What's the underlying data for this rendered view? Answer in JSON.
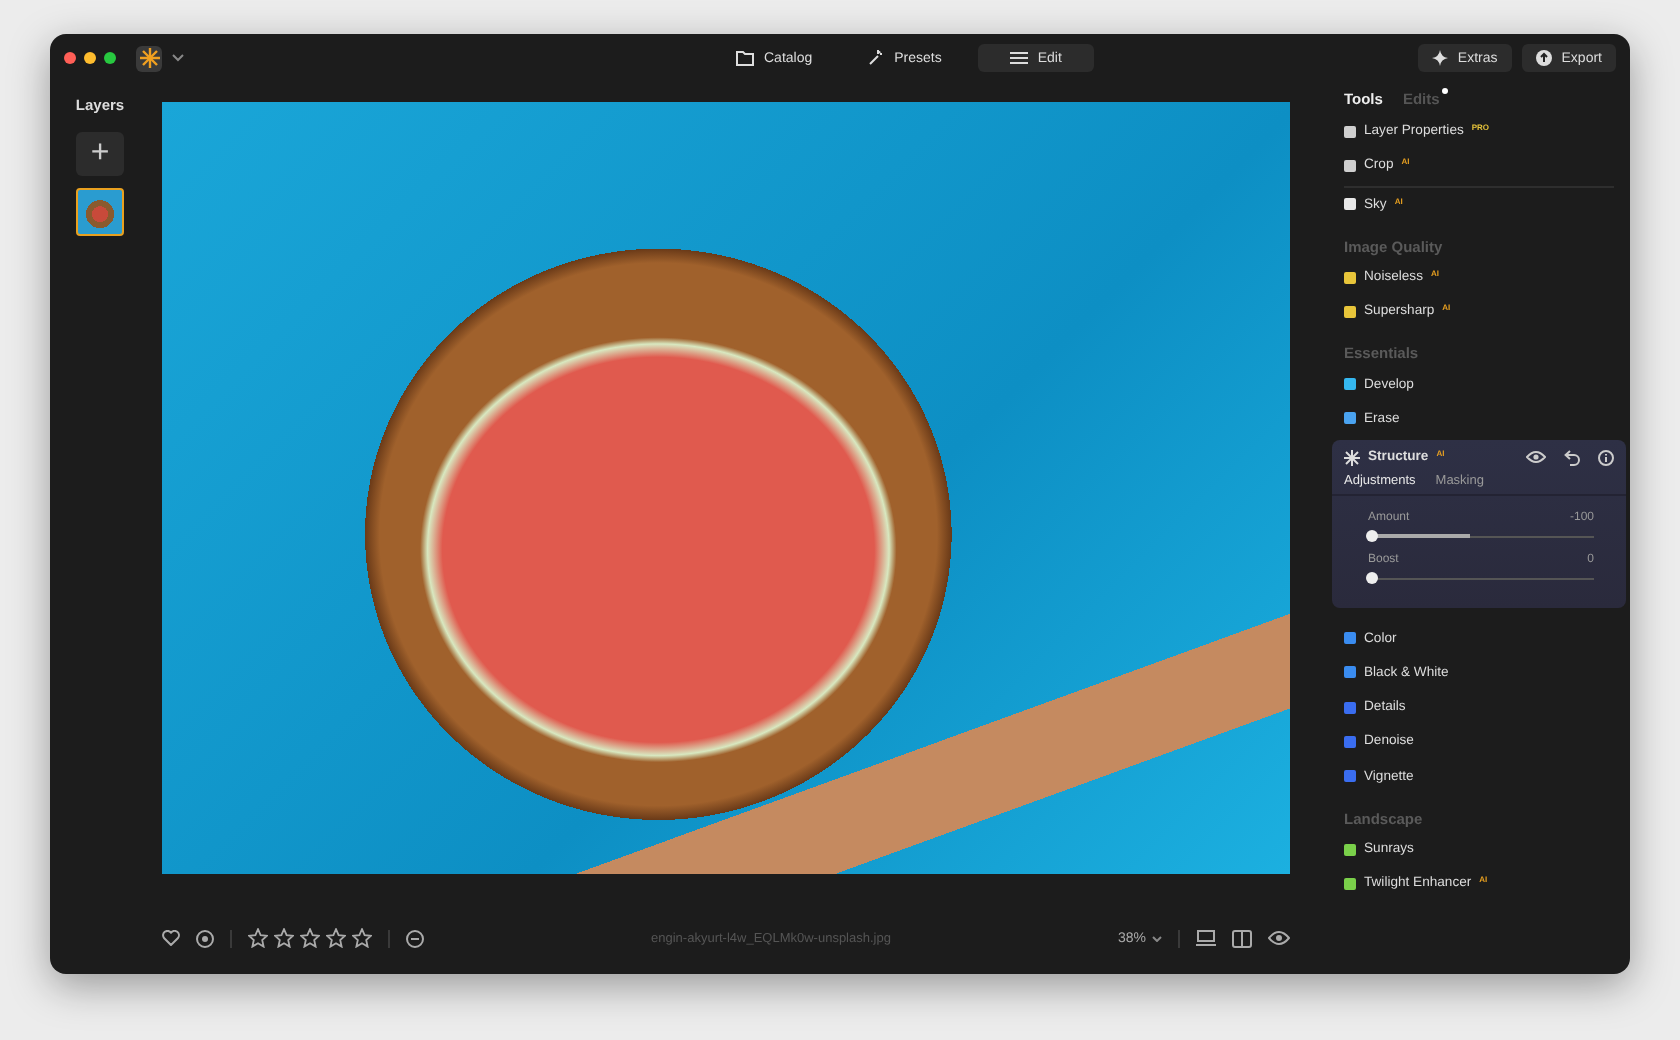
{
  "titlebar": {
    "tabs": [
      {
        "label": "Catalog",
        "selected": false
      },
      {
        "label": "Presets",
        "selected": false
      },
      {
        "label": "Edit",
        "selected": true
      }
    ],
    "buttons": [
      "Extras",
      "Export"
    ]
  },
  "layers": {
    "title": "Layers",
    "add": "+"
  },
  "panel": {
    "tabs": [
      {
        "label": "Tools",
        "selected": true
      },
      {
        "label": "Edits",
        "selected": false,
        "dot": true
      }
    ],
    "sections": [
      {
        "items": [
          {
            "label": "Layer Properties",
            "badge": "PRO"
          },
          {
            "label": "Crop",
            "badge": "AI"
          }
        ]
      },
      {
        "items": [
          {
            "label": "Sky",
            "badge": "AI"
          }
        ]
      },
      {
        "title": "Image Quality",
        "items": [
          {
            "label": "Noiseless",
            "badge": "AI"
          },
          {
            "label": "Supersharp",
            "badge": "AI"
          }
        ]
      },
      {
        "title": "Essentials",
        "items": [
          {
            "label": "Develop"
          },
          {
            "label": "Erase"
          }
        ]
      },
      {
        "card": {
          "label": "Structure",
          "badge": "AI",
          "tabs": [
            {
              "label": "Adjustments",
              "selected": true
            },
            {
              "label": "Masking",
              "selected": false
            }
          ],
          "sliders": [
            {
              "name": "Amount",
              "reading": "-100",
              "level": 0
            },
            {
              "name": "Boost",
              "reading": "0",
              "level": 0
            }
          ]
        },
        "items": [
          {
            "label": "Color"
          },
          {
            "label": "Black & White"
          },
          {
            "label": "Details"
          },
          {
            "label": "Denoise"
          },
          {
            "label": "Vignette"
          }
        ]
      },
      {
        "title": "Landscape",
        "items": [
          {
            "label": "Sunrays"
          },
          {
            "label": "Twilight Enhancer",
            "badge": "AI"
          }
        ]
      }
    ]
  },
  "bottom": {
    "stars": 0,
    "filename": "engin-akyurt-l4w_EQLMk0w-unsplash.jpg",
    "zoom": "38%"
  }
}
